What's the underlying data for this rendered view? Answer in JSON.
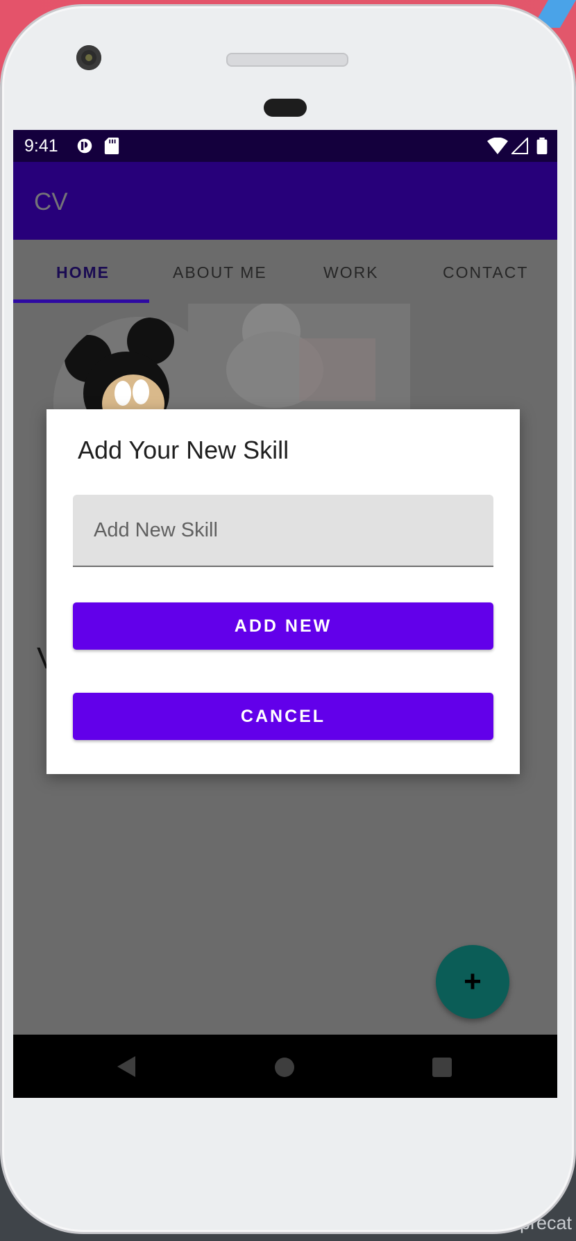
{
  "status_bar": {
    "time": "9:41"
  },
  "app_bar": {
    "title": "CV"
  },
  "tabs": [
    {
      "label": "HOME",
      "selected": true
    },
    {
      "label": "ABOUT ME",
      "selected": false
    },
    {
      "label": "WORK",
      "selected": false
    },
    {
      "label": "CONTACT",
      "selected": false
    }
  ],
  "background_partial_text": "V",
  "dialog": {
    "title": "Add Your New Skill",
    "input_placeholder": "Add New Skill",
    "input_value": "",
    "add_button": "ADD NEW",
    "cancel_button": "CANCEL"
  },
  "fab": {
    "icon": "plus-icon",
    "label": "+"
  },
  "nav_bar": {
    "back": "back-icon",
    "home": "home-icon",
    "recents": "recents-icon"
  },
  "backdrop_text": "precat",
  "colors": {
    "primary": "#6200ea",
    "app_bar": "#27007a",
    "status_bar": "#14003d",
    "fab": "#0b5d57"
  }
}
